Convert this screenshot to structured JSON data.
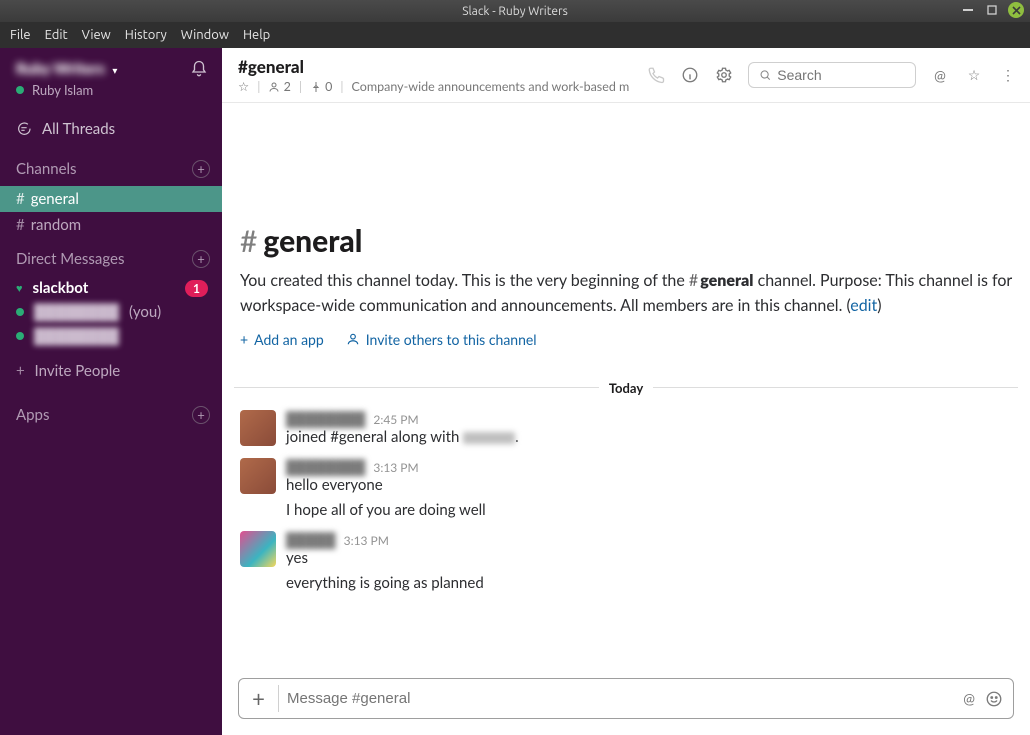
{
  "window": {
    "title": "Slack - Ruby Writers"
  },
  "menu": {
    "file": "File",
    "edit": "Edit",
    "view": "View",
    "history": "History",
    "window": "Window",
    "help": "Help"
  },
  "sidebar": {
    "workspace_name": "Ruby Writers",
    "user_name": "Ruby Islam",
    "all_threads": "All Threads",
    "channels_header": "Channels",
    "channels": [
      {
        "name": "general",
        "active": true
      },
      {
        "name": "random",
        "active": false
      }
    ],
    "dm_header": "Direct Messages",
    "dms": {
      "slackbot": "slackbot",
      "slackbot_badge": "1",
      "you_suffix": "(you)"
    },
    "invite": "Invite People",
    "apps": "Apps"
  },
  "header": {
    "channel_name": "#general",
    "members": "2",
    "pins": "0",
    "topic": "Company-wide announcements and work-based m",
    "search_placeholder": "Search"
  },
  "intro": {
    "title": "general",
    "text_before": "You created this channel today. This is the very beginning of the ",
    "channel_strong": "general",
    "text_after": " channel. Purpose: This channel is for workspace-wide communication and announcements. All members are in this channel. (",
    "edit": "edit",
    "text_close": ")",
    "add_app": "Add an app",
    "invite": "Invite others to this channel"
  },
  "divider": {
    "today": "Today"
  },
  "messages": [
    {
      "time": "2:45 PM",
      "text_before": "joined #general along with ",
      "text_after": "."
    },
    {
      "time": "3:13 PM",
      "text": "hello everyone"
    },
    {
      "follow_text": "I hope all of you are doing well"
    },
    {
      "time": "3:13 PM",
      "text": "yes"
    },
    {
      "follow_text": "everything is going as planned"
    }
  ],
  "composer": {
    "placeholder": "Message #general"
  }
}
